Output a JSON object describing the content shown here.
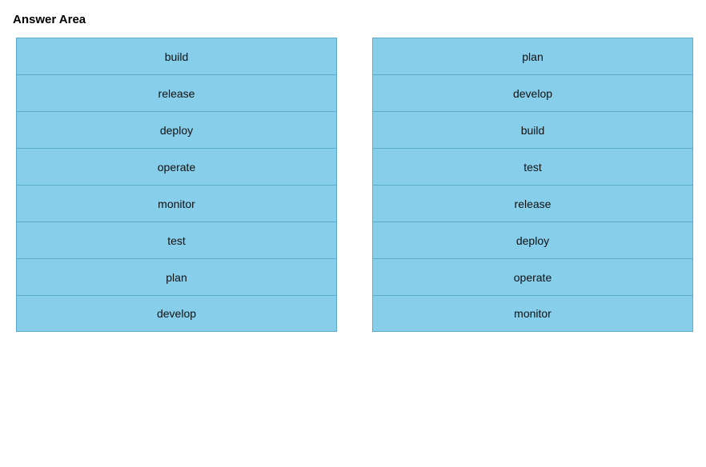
{
  "title": "Answer Area",
  "left_column": {
    "items": [
      {
        "label": "build"
      },
      {
        "label": "release"
      },
      {
        "label": "deploy"
      },
      {
        "label": "operate"
      },
      {
        "label": "monitor"
      },
      {
        "label": "test"
      },
      {
        "label": "plan"
      },
      {
        "label": "develop"
      }
    ]
  },
  "right_column": {
    "items": [
      {
        "label": "plan"
      },
      {
        "label": "develop"
      },
      {
        "label": "build"
      },
      {
        "label": "test"
      },
      {
        "label": "release"
      },
      {
        "label": "deploy"
      },
      {
        "label": "operate"
      },
      {
        "label": "monitor"
      }
    ]
  }
}
